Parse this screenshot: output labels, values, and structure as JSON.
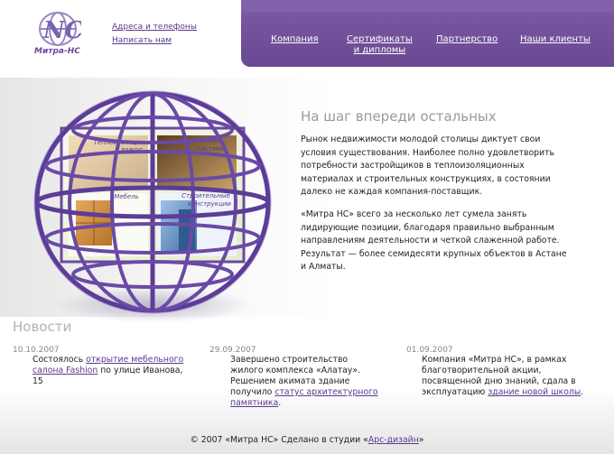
{
  "header": {
    "logo_text": "Митра-НС",
    "links": [
      "Адреса и телефоны",
      "Написать нам"
    ]
  },
  "nav": {
    "items": [
      {
        "line1": "Компания",
        "line2": ""
      },
      {
        "line1": "Сертификаты",
        "line2": "и дипломы"
      },
      {
        "line1": "Партнерство",
        "line2": ""
      },
      {
        "line1": "Наши клиенты",
        "line2": ""
      }
    ]
  },
  "hero": {
    "tiles": [
      {
        "line1": "Теплоизоляция",
        "line2": "PAROC"
      },
      {
        "line1": "Потолочные",
        "line2": "системы"
      },
      {
        "line1": "Мебель",
        "line2": ""
      },
      {
        "line1": "Строительные",
        "line2": "конструкции"
      }
    ]
  },
  "main": {
    "headline": "На шаг впереди остальных",
    "para1": "Рынок недвижимости молодой столицы диктует свои условия существования. Наиболее полно удовлетворить потребности застройщиков в теплоизоляционных материалах и строительных конструкциях, в состоянии далеко не каждая компания-поставщик.",
    "para2": "«Митра НС» всего за несколько лет сумела занять лидирующие позиции, благодаря правильно выбранным направлениям деятельности и четкой слаженной работе. Результат — более семидесяти крупных объектов в Астане и Алматы."
  },
  "news": {
    "title": "Новости",
    "items": [
      {
        "date": "10.10.2007",
        "pre": "Состоялось ",
        "link": "открытие мебельного салона Fashion",
        "post": " по улице Иванова, 15"
      },
      {
        "date": "29.09.2007",
        "pre": "Завершено строительство жилого комплекса «Алатау». Решением акимата здание получило ",
        "link": "статус архитектурного памятника",
        "post": "."
      },
      {
        "date": "01.09.2007",
        "pre": "Компания «Митра НС», в рамках благотворительной акции, посвященной дню знаний, сдала в эксплуатацию ",
        "link": "здание новой школы",
        "post": "."
      }
    ]
  },
  "footer": {
    "pre": "© 2007 «Митра НС» Сделано в студии «",
    "link": "Арс-дизайн",
    "post": "»"
  },
  "colors": {
    "brand": "#6a4892",
    "link": "#5a3a8c"
  }
}
